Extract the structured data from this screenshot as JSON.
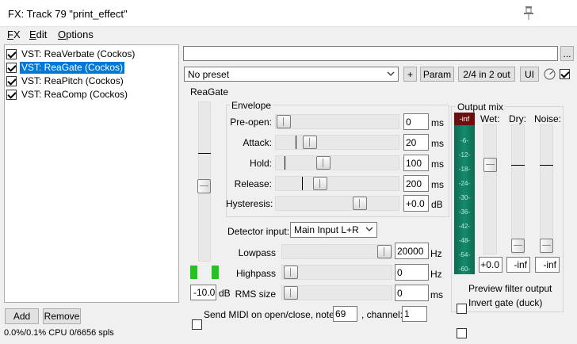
{
  "window": {
    "title": "FX: Track 79 \"print_effect\""
  },
  "menu": {
    "fx_label": "FX",
    "fx_accel": "F",
    "fx_rest": "X",
    "edit_accel": "E",
    "edit_rest": "dit",
    "options_accel": "O",
    "options_rest": "ptions"
  },
  "fx_chain": {
    "items": [
      {
        "label": "VST: ReaVerbate (Cockos)",
        "enabled": true,
        "selected": false
      },
      {
        "label": "VST: ReaGate (Cockos)",
        "enabled": true,
        "selected": true
      },
      {
        "label": "VST: ReaPitch (Cockos)",
        "enabled": true,
        "selected": false
      },
      {
        "label": "VST: ReaComp (Cockos)",
        "enabled": true,
        "selected": false
      }
    ],
    "add_label": "Add",
    "remove_label": "Remove",
    "cpu_status": "0.0%/0.1% CPU 0/6656 spls"
  },
  "toolbar": {
    "browse_label": "...",
    "preset_value": "No preset",
    "add_preset_label": "+",
    "param_label": "Param",
    "io_label": "2/4 in 2 out",
    "ui_label": "UI",
    "enabled": true
  },
  "plugin": {
    "name": "ReaGate",
    "threshold": {
      "value": "-10.0",
      "unit": "dB",
      "level": 0.45
    },
    "envelope": {
      "label": "Envelope",
      "params": [
        {
          "name": "Pre-open:",
          "value": "0",
          "unit": "ms",
          "pos": 0.0,
          "marker": null
        },
        {
          "name": "Attack:",
          "value": "20",
          "unit": "ms",
          "pos": 0.13,
          "marker": 0.06
        },
        {
          "name": "Hold:",
          "value": "100",
          "unit": "ms",
          "pos": 0.22,
          "marker": 0.0
        },
        {
          "name": "Release:",
          "value": "200",
          "unit": "ms",
          "pos": 0.19,
          "marker": 0.21
        },
        {
          "name": "Hysteresis:",
          "value": "+0.0",
          "unit": "dB",
          "pos": 0.57,
          "marker": null
        }
      ]
    },
    "detector": {
      "label": "Detector input:",
      "value": "Main Input L+R"
    },
    "filters": [
      {
        "name": "Lowpass",
        "value": "20000",
        "unit": "Hz",
        "pos": 0.92
      },
      {
        "name": "Highpass",
        "value": "0",
        "unit": "Hz",
        "pos": 0.0
      },
      {
        "name": "RMS size",
        "value": "0",
        "unit": "ms",
        "pos": 0.0
      }
    ],
    "midi": {
      "label": "Send MIDI on open/close, note:",
      "note": "69",
      "channel_label": ", channel:",
      "channel": "1",
      "enabled": false
    },
    "output_mix": {
      "label": "Output mix",
      "meter_peak": "-inf",
      "meter_ticks": [
        "-6-",
        "-12-",
        "-18-",
        "-24-",
        "-30-",
        "-36-",
        "-42-",
        "-48-",
        "-54-",
        "-60-"
      ],
      "wet_label": "Wet:",
      "dry_label": "Dry:",
      "noise_label": "Noise:",
      "wet_value": "+0.0",
      "dry_value": "-inf",
      "noise_value": "-inf",
      "wet_level": 0.27,
      "dry_level": 1.0,
      "noise_level": 1.0
    },
    "preview_filter_label": "Preview filter output",
    "invert_gate_label": "Invert gate (duck)",
    "preview_filter": false,
    "invert_gate": false
  }
}
